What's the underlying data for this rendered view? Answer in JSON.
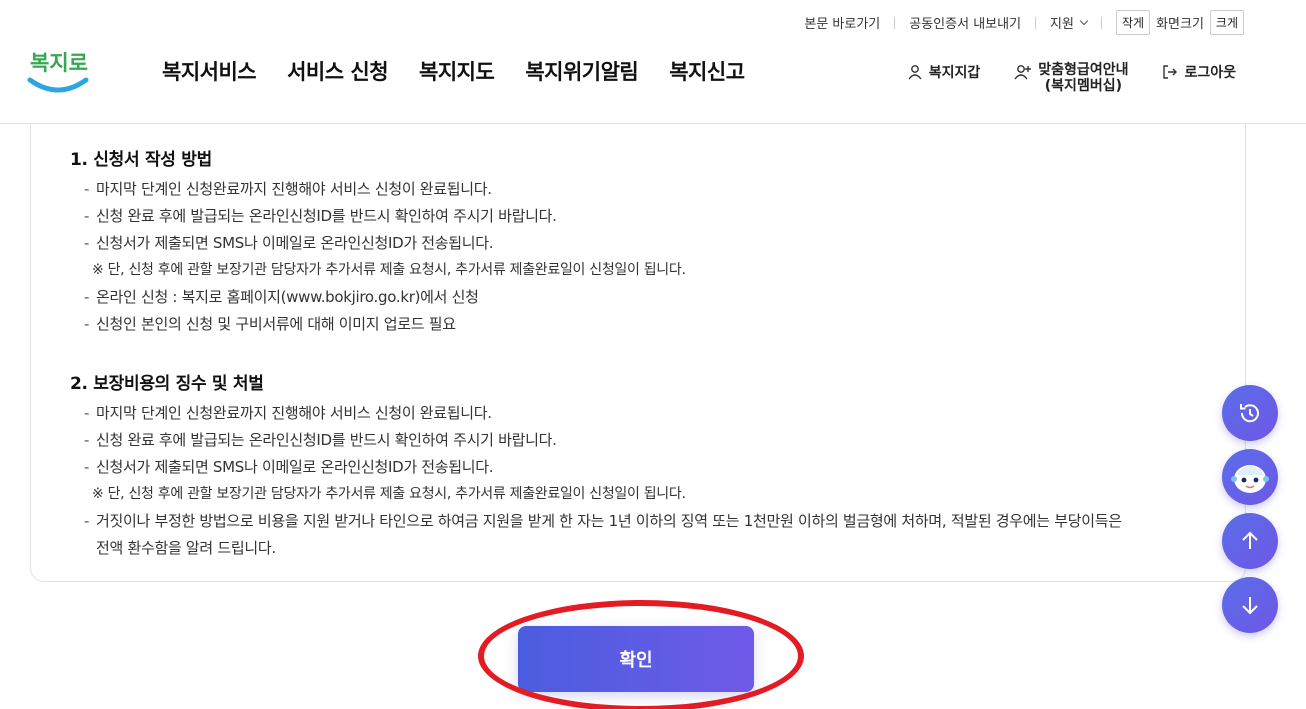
{
  "util": {
    "skip_link": "본문 바로가기",
    "cert_export": "공동인증서 내보내기",
    "support": "지원",
    "font_small": "작게",
    "font_size_label": "화면크기",
    "font_large": "크게"
  },
  "logo": {
    "text": "복지로"
  },
  "gnb": {
    "items": [
      "복지서비스",
      "서비스 신청",
      "복지지도",
      "복지위기알림",
      "복지신고"
    ]
  },
  "user_menu": {
    "wallet": "복지지갑",
    "membership_line1": "맞춤형급여안내",
    "membership_line2": "(복지멤버십)",
    "logout": "로그아웃"
  },
  "sections": [
    {
      "title": "1. 신청서 작성 방법",
      "items": [
        {
          "type": "dash",
          "text": "마지막 단계인 신청완료까지 진행해야 서비스 신청이 완료됩니다."
        },
        {
          "type": "dash",
          "text": "신청 완료 후에 발급되는 온라인신청ID를 반드시 확인하여 주시기 바랍니다."
        },
        {
          "type": "dash",
          "text": "신청서가 제출되면 SMS나 이메일로 온라인신청ID가 전송됩니다."
        },
        {
          "type": "note",
          "text": "※ 단, 신청 후에 관할 보장기관 담당자가 추가서류 제출 요청시, 추가서류 제출완료일이 신청일이 됩니다."
        },
        {
          "type": "dash",
          "text": "온라인 신청 : 복지로 홈페이지(www.bokjiro.go.kr)에서 신청"
        },
        {
          "type": "dash",
          "text": "신청인 본인의 신청 및 구비서류에 대해 이미지 업로드 필요"
        }
      ]
    },
    {
      "title": "2. 보장비용의 징수 및 처벌",
      "items": [
        {
          "type": "dash",
          "text": "마지막 단계인 신청완료까지 진행해야 서비스 신청이 완료됩니다."
        },
        {
          "type": "dash",
          "text": "신청 완료 후에 발급되는 온라인신청ID를 반드시 확인하여 주시기 바랍니다."
        },
        {
          "type": "dash",
          "text": "신청서가 제출되면 SMS나 이메일로 온라인신청ID가 전송됩니다."
        },
        {
          "type": "note",
          "text": "※ 단, 신청 후에 관할 보장기관 담당자가 추가서류 제출 요청시, 추가서류 제출완료일이 신청일이 됩니다."
        },
        {
          "type": "dash",
          "text": "거짓이나 부정한 방법으로 비용을 지원 받거나 타인으로 하여금 지원을 받게 한 자는 1년 이하의 징역 또는 1천만원 이하의 벌금형에 처하며, 적발된 경우에는 부당이득은",
          "text2": "전액 환수함을 알려 드립니다."
        }
      ]
    }
  ],
  "confirm_button": "확인",
  "floating": {
    "history_icon": "history-icon",
    "chatbot_icon": "chatbot-icon",
    "top_icon": "arrow-up-icon",
    "bottom_icon": "arrow-down-icon"
  },
  "colors": {
    "accent": "#5a5fe4",
    "highlight": "#e31b23",
    "logo_blue": "#2ba6e0"
  }
}
